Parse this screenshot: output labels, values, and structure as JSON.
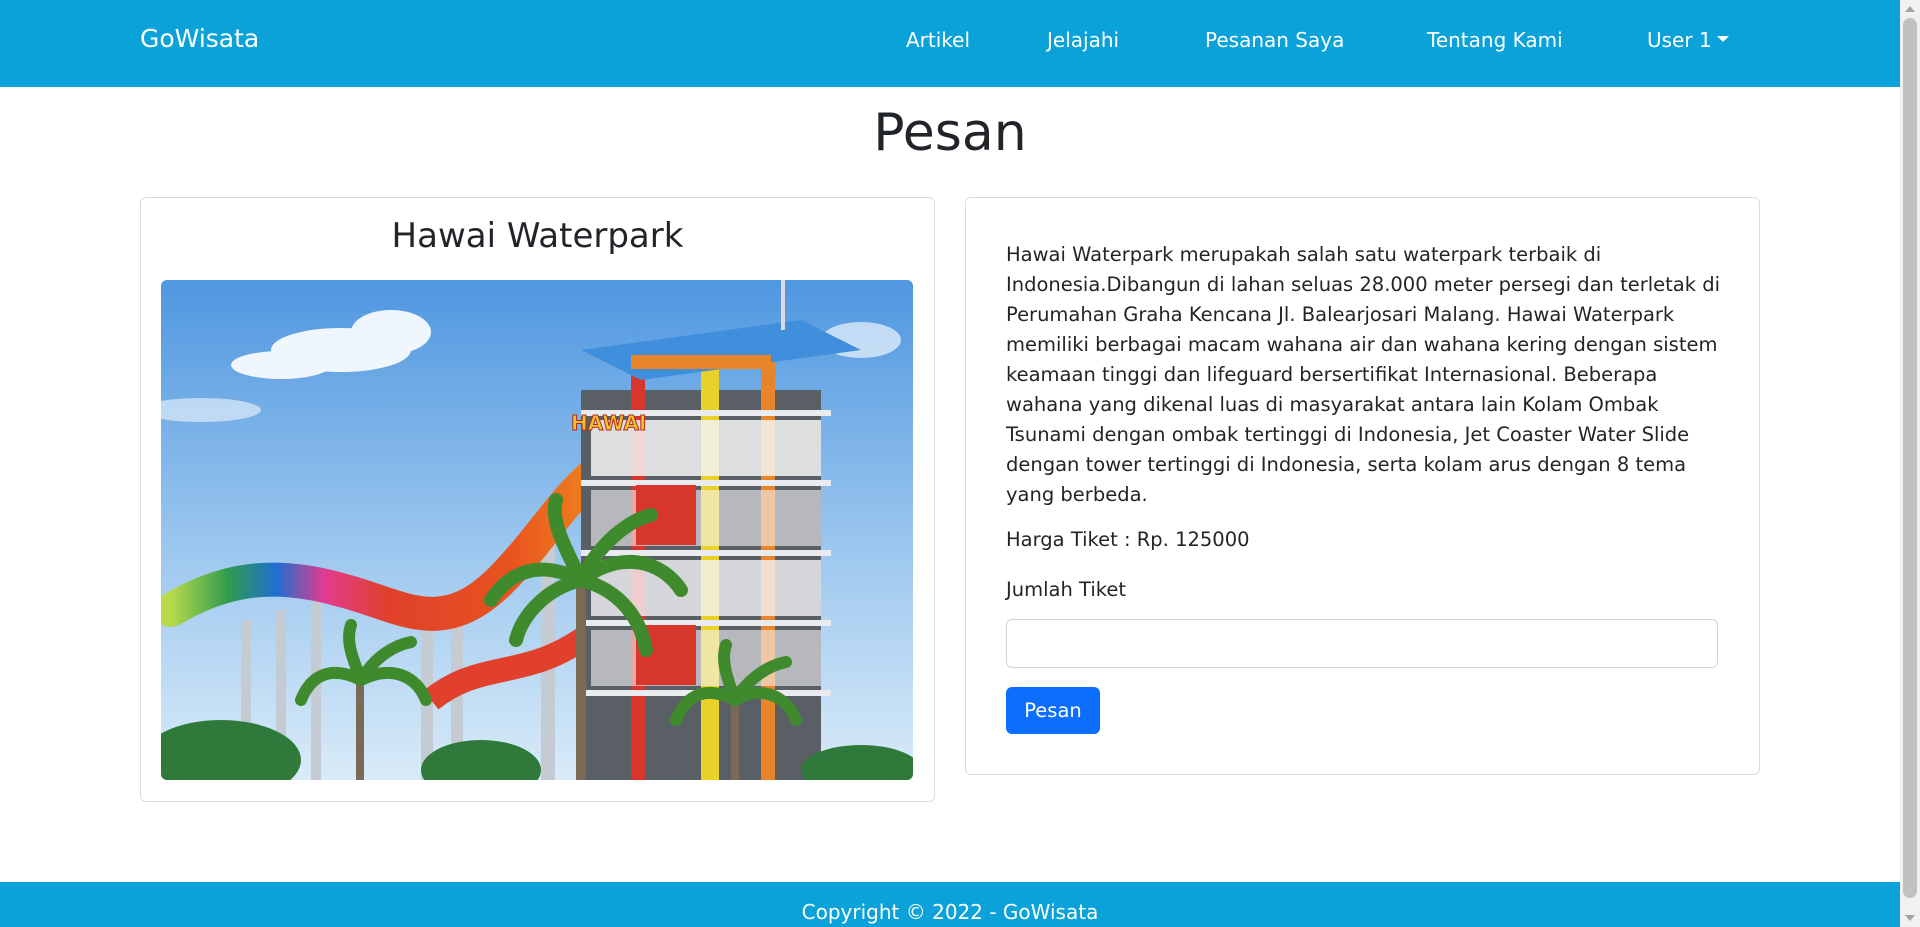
{
  "navbar": {
    "brand": "GoWisata",
    "links": [
      "Artikel",
      "Jelajahi",
      "Pesanan Saya",
      "Tentang Kami"
    ],
    "user_menu": "User 1"
  },
  "page": {
    "title": "Pesan"
  },
  "destination": {
    "name": "Hawai Waterpark",
    "sign_text": "HAWAI",
    "description": "Hawai Waterpark merupakah salah satu waterpark terbaik di Indonesia.Dibangun di lahan seluas 28.000 meter persegi dan terletak di Perumahan Graha Kencana Jl. Balearjosari Malang. Hawai Waterpark memiliki berbagai macam wahana air dan wahana kering dengan sistem keamaan tinggi dan lifeguard bersertifikat Internasional. Beberapa wahana yang dikenal luas di masyarakat antara lain Kolam Ombak Tsunami dengan ombak tertinggi di Indonesia, Jet Coaster Water Slide dengan tower tertinggi di Indonesia, serta kolam arus dengan 8 tema yang berbeda.",
    "price_text": "Harga Tiket : Rp. 125000"
  },
  "form": {
    "qty_label": "Jumlah Tiket",
    "qty_value": "",
    "submit_label": "Pesan"
  },
  "footer": {
    "text": "Copyright © 2022 - GoWisata"
  },
  "colors": {
    "navbar": "#0ba1d9",
    "primary_button": "#0d6efd"
  }
}
